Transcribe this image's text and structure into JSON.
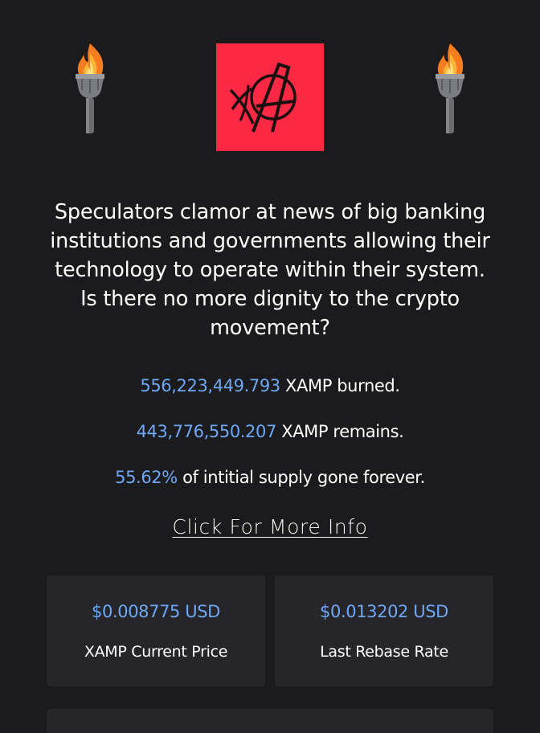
{
  "hero": {
    "left_icon": "torch-icon",
    "right_icon": "torch-icon",
    "logo_icon": "xamp-anarchy-logo",
    "logo_color": "#fc2844",
    "flame_color": "#f57c1f"
  },
  "headline": "Speculators clamor at news of big banking institutions and governments allowing their technology to operate within their system. Is there no more dignity to the crypto movement?",
  "stats": {
    "burned_value": "556,223,449.793",
    "burned_text": "XAMP burned.",
    "remaining_value": "443,776,550.207",
    "remaining_text": "XAMP remains.",
    "gone_value": "55.62%",
    "gone_text": "of intitial supply gone forever."
  },
  "more_info_link": "Click For More Info",
  "cards": [
    {
      "value": "$0.008775 USD",
      "label": "XAMP Current Price"
    },
    {
      "value": "$0.013202 USD",
      "label": "Last Rebase Rate"
    }
  ],
  "colors": {
    "background": "#1b1b1d",
    "card": "#25252a",
    "accent": "#6ea8f5"
  }
}
